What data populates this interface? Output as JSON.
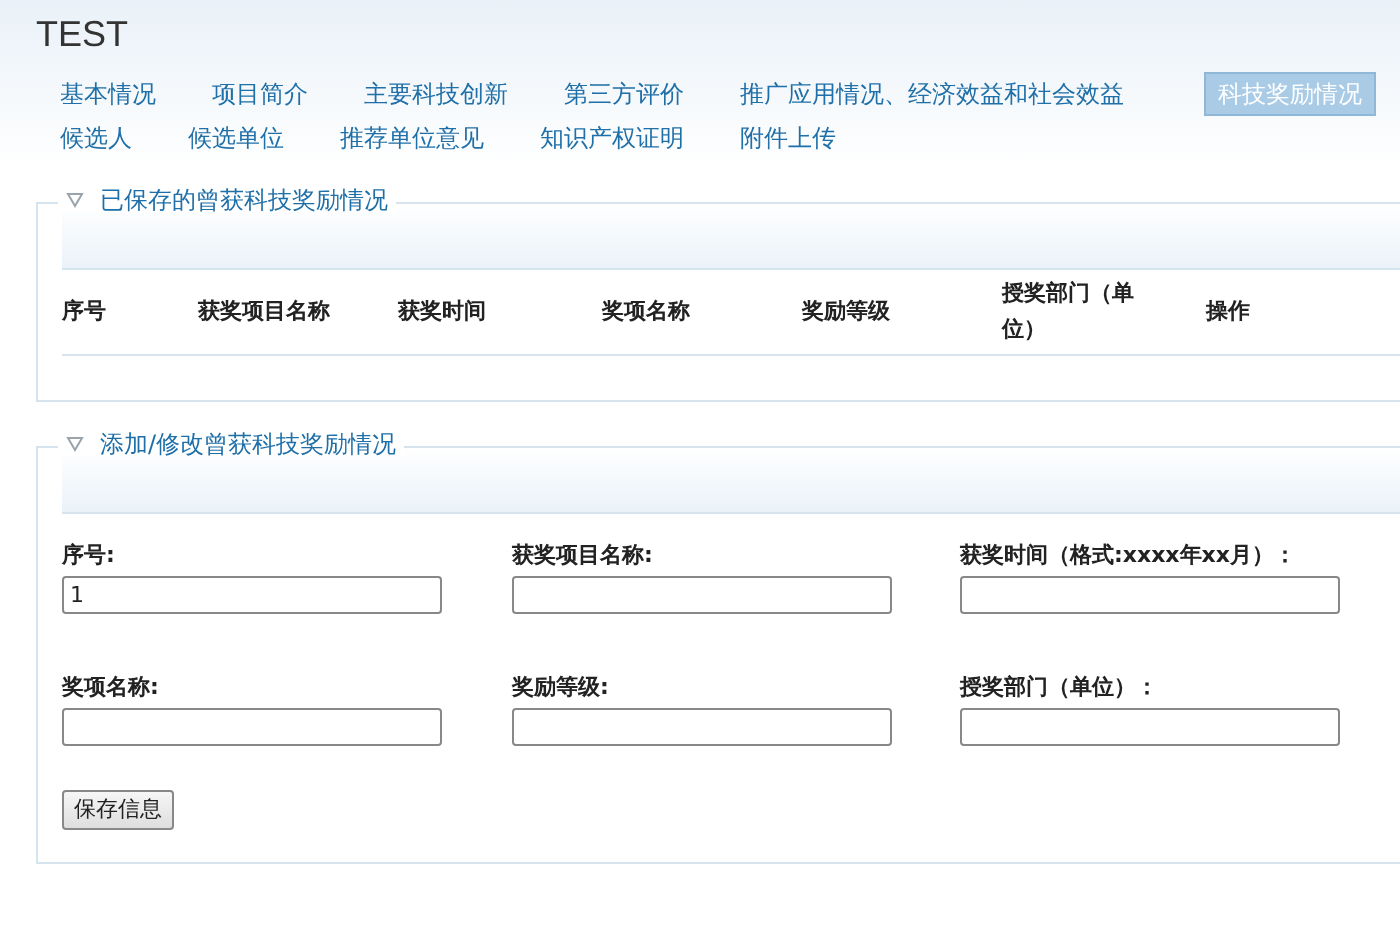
{
  "title": "TEST",
  "tabs": [
    [
      {
        "label": "基本情况",
        "selected": false
      },
      {
        "label": "项目简介",
        "selected": false
      },
      {
        "label": "主要科技创新",
        "selected": false
      },
      {
        "label": "第三方评价",
        "selected": false
      },
      {
        "label": "推广应用情况、经济效益和社会效益",
        "selected": false
      },
      {
        "label": "科技奖励情况",
        "selected": true
      }
    ],
    [
      {
        "label": "候选人",
        "selected": false
      },
      {
        "label": "候选单位",
        "selected": false
      },
      {
        "label": "推荐单位意见",
        "selected": false
      },
      {
        "label": "知识产权证明",
        "selected": false
      },
      {
        "label": "附件上传",
        "selected": false
      }
    ]
  ],
  "saved_section": {
    "legend": "已保存的曾获科技奖励情况",
    "expanded": true,
    "table": {
      "columns": [
        "序号",
        "获奖项目名称",
        "获奖时间",
        "奖项名称",
        "奖励等级",
        "授奖部门（单位）",
        "操作"
      ]
    }
  },
  "edit_section": {
    "legend": "添加/修改曾获科技奖励情况",
    "expanded": true,
    "fields": [
      {
        "label": "序号:",
        "value": "1"
      },
      {
        "label": "获奖项目名称:"
      },
      {
        "label": "获奖时间（格式:xxxx年xx月）："
      },
      {
        "label": "奖项名称:"
      },
      {
        "label": "奖励等级:"
      },
      {
        "label": "授奖部门（单位）："
      }
    ],
    "button": "保存信息"
  }
}
